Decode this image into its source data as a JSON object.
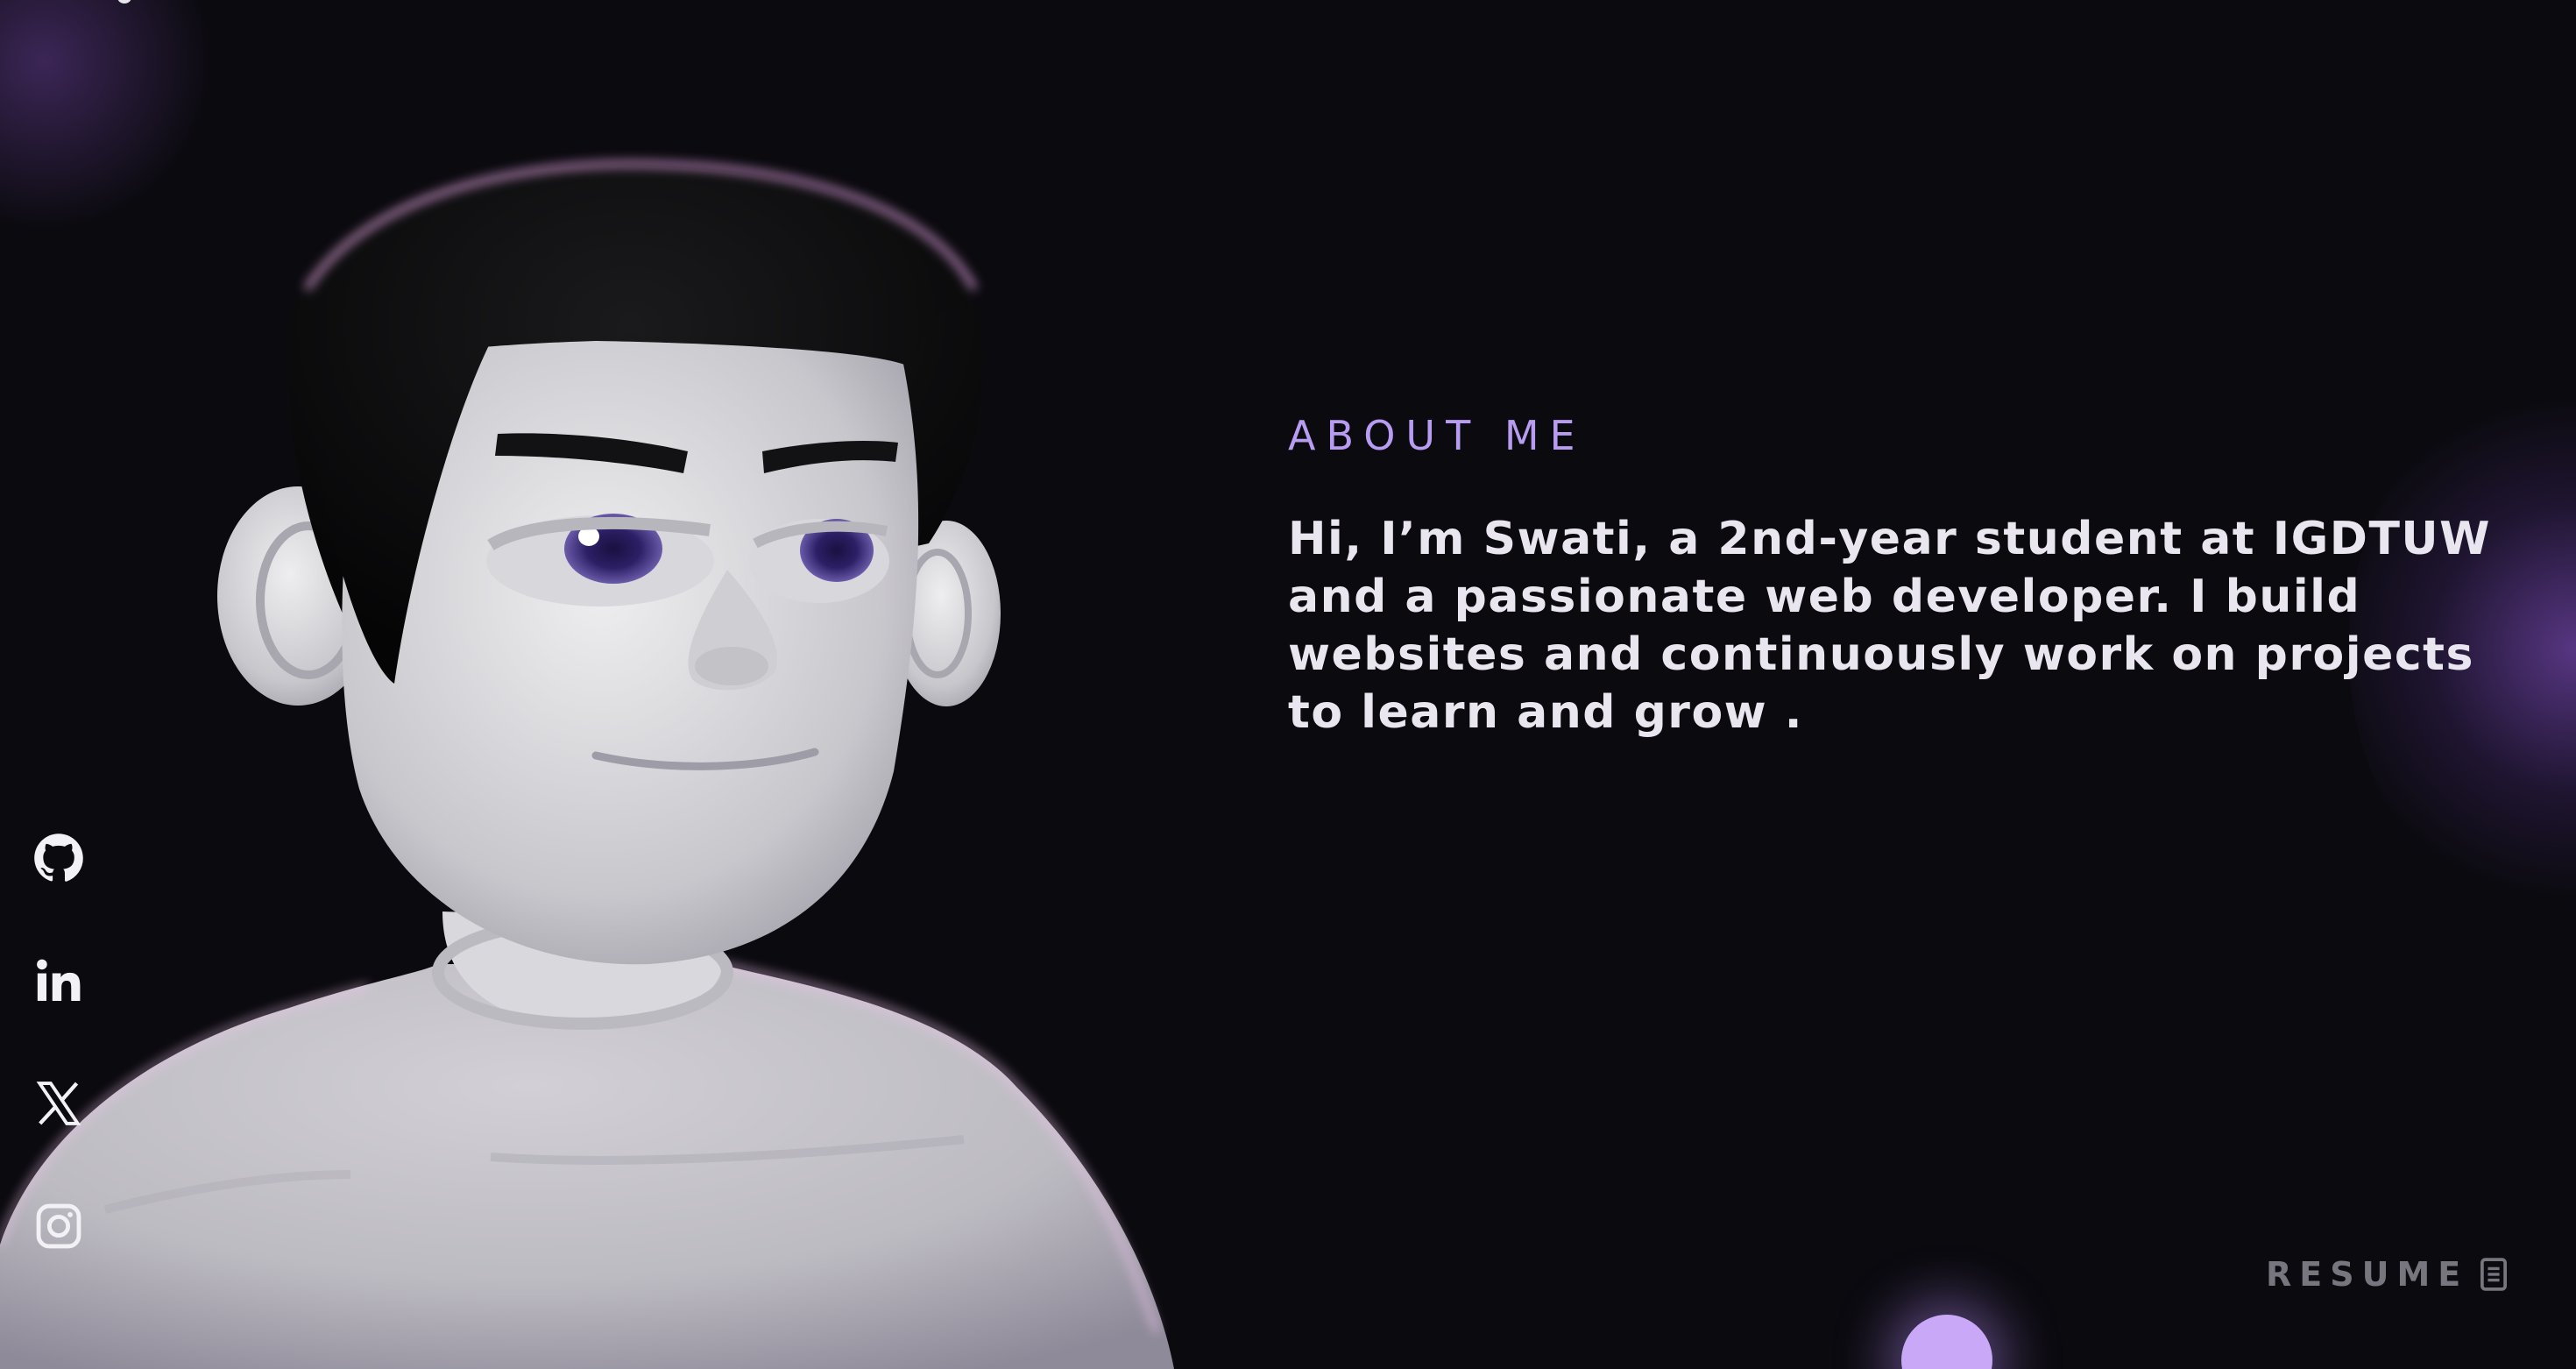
{
  "about": {
    "heading": "ABOUT ME",
    "body": "Hi, I’m Swati, a 2nd-year student at IGDTUW and a passionate web developer. I build websites and continuously work on projects to learn and grow ."
  },
  "socials": [
    {
      "name": "github-icon"
    },
    {
      "name": "linkedin-icon"
    },
    {
      "name": "x-icon"
    },
    {
      "name": "instagram-icon"
    }
  ],
  "resume": {
    "label": "RESUME",
    "icon": "document-icon"
  },
  "colors": {
    "background": "#0b0a0f",
    "accent": "#b79cf2",
    "text": "#e9e6f0",
    "muted": "#77757e",
    "orb": "#c9a9f7"
  }
}
